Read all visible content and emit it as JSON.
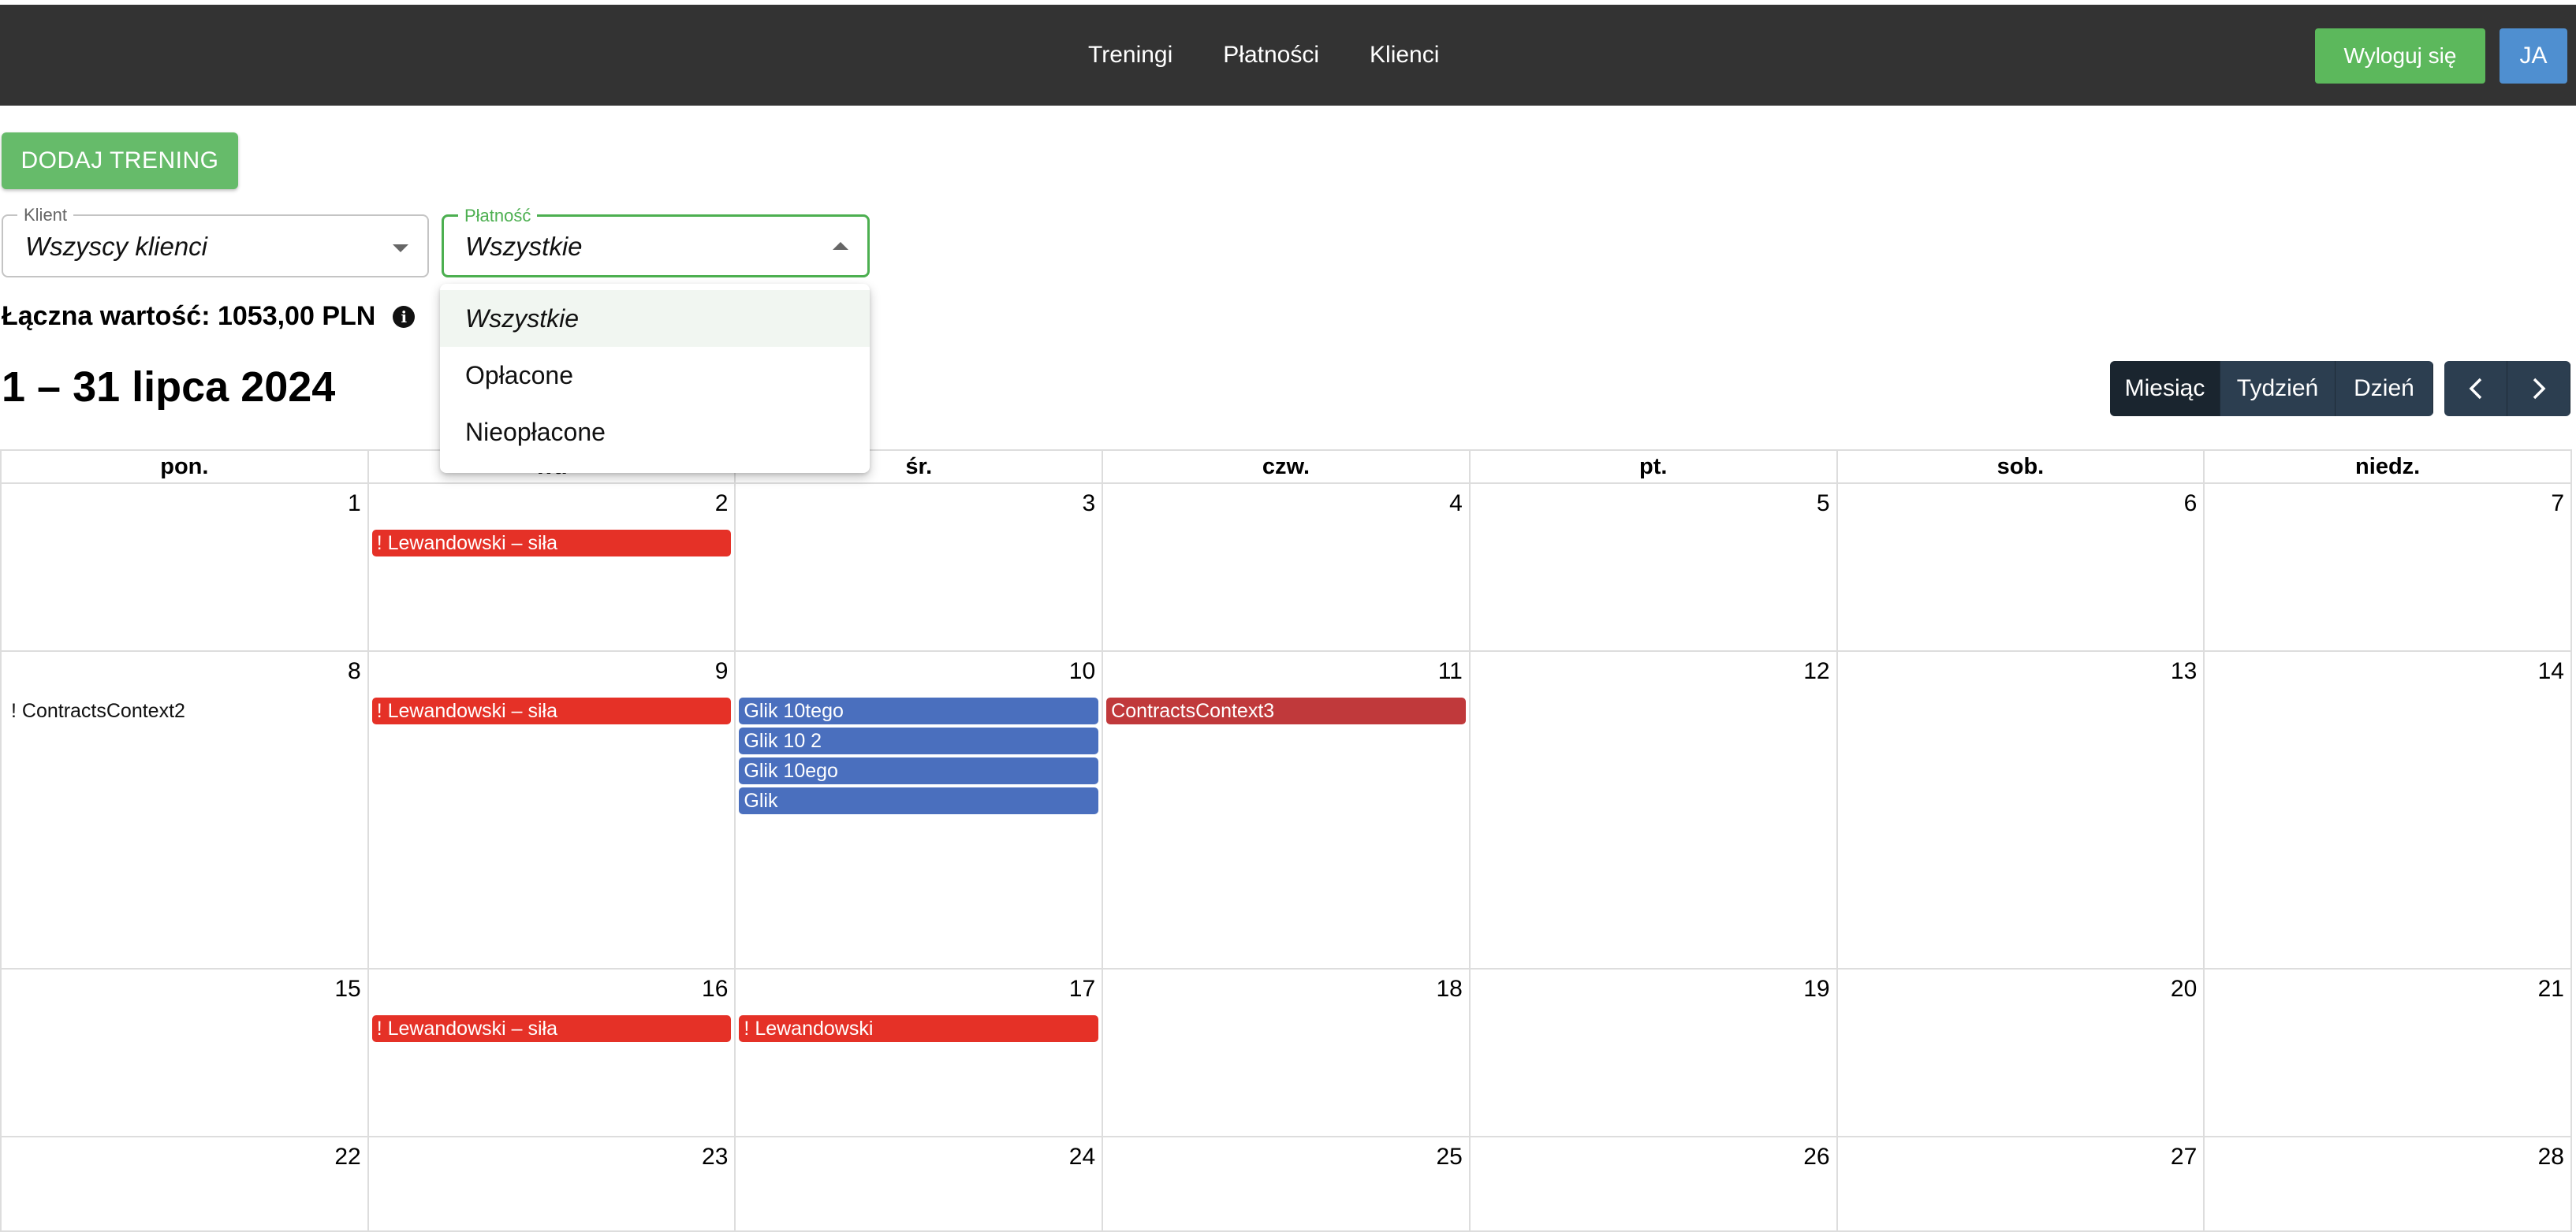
{
  "nav": {
    "links": [
      "Treningi",
      "Płatności",
      "Klienci"
    ],
    "logout_label": "Wyloguj się",
    "avatar_initials": "JA"
  },
  "add_button_label": "DODAJ TRENING",
  "filters": {
    "client": {
      "label": "Klient",
      "value": "Wszyscy klienci"
    },
    "payment": {
      "label": "Płatność",
      "value": "Wszystkie"
    }
  },
  "dropdown": {
    "options": [
      "Wszystkie",
      "Opłacone",
      "Nieopłacone"
    ],
    "selected_index": 0
  },
  "total": {
    "text": "Łączna wartość: 1053,00 PLN"
  },
  "calendar": {
    "title": "1 – 31 lipca 2024",
    "views": [
      "Miesiąc",
      "Tydzień",
      "Dzień"
    ],
    "active_view": "Miesiąc",
    "weekdays": [
      "pon.",
      "wt.",
      "śr.",
      "czw.",
      "pt.",
      "sob.",
      "niedz."
    ],
    "weeks": [
      [
        {
          "day": "1",
          "events": []
        },
        {
          "day": "2",
          "events": [
            {
              "title": "! Lewandowski – siła",
              "color": "red"
            }
          ]
        },
        {
          "day": "3",
          "events": []
        },
        {
          "day": "4",
          "events": []
        },
        {
          "day": "5",
          "events": []
        },
        {
          "day": "6",
          "events": []
        },
        {
          "day": "7",
          "events": []
        }
      ],
      [
        {
          "day": "8",
          "events": [
            {
              "title": "! ContractsContext2",
              "color": "plain"
            }
          ]
        },
        {
          "day": "9",
          "events": [
            {
              "title": "! Lewandowski – siła",
              "color": "red"
            }
          ]
        },
        {
          "day": "10",
          "events": [
            {
              "title": "Glik 10tego",
              "color": "blue"
            },
            {
              "title": "Glik 10 2",
              "color": "blue"
            },
            {
              "title": "Glik 10ego",
              "color": "blue"
            },
            {
              "title": "Glik",
              "color": "blue"
            }
          ]
        },
        {
          "day": "11",
          "events": [
            {
              "title": "ContractsContext3",
              "color": "darkred"
            }
          ]
        },
        {
          "day": "12",
          "events": []
        },
        {
          "day": "13",
          "events": []
        },
        {
          "day": "14",
          "events": []
        }
      ],
      [
        {
          "day": "15",
          "events": []
        },
        {
          "day": "16",
          "events": [
            {
              "title": "! Lewandowski – siła",
              "color": "red"
            }
          ]
        },
        {
          "day": "17",
          "events": [
            {
              "title": "! Lewandowski",
              "color": "red"
            }
          ]
        },
        {
          "day": "18",
          "events": []
        },
        {
          "day": "19",
          "events": []
        },
        {
          "day": "20",
          "events": []
        },
        {
          "day": "21",
          "events": []
        }
      ],
      [
        {
          "day": "22",
          "events": []
        },
        {
          "day": "23",
          "events": []
        },
        {
          "day": "24",
          "events": []
        },
        {
          "day": "25",
          "events": []
        },
        {
          "day": "26",
          "events": []
        },
        {
          "day": "27",
          "events": []
        },
        {
          "day": "28",
          "events": []
        }
      ]
    ]
  },
  "colors": {
    "navbar": "#333333",
    "green": "#5cb85c",
    "event_red": "#e53127",
    "event_blue": "#4a6fbe",
    "event_darkred": "#c0393b",
    "toolbar_dark": "#2c3e50"
  }
}
